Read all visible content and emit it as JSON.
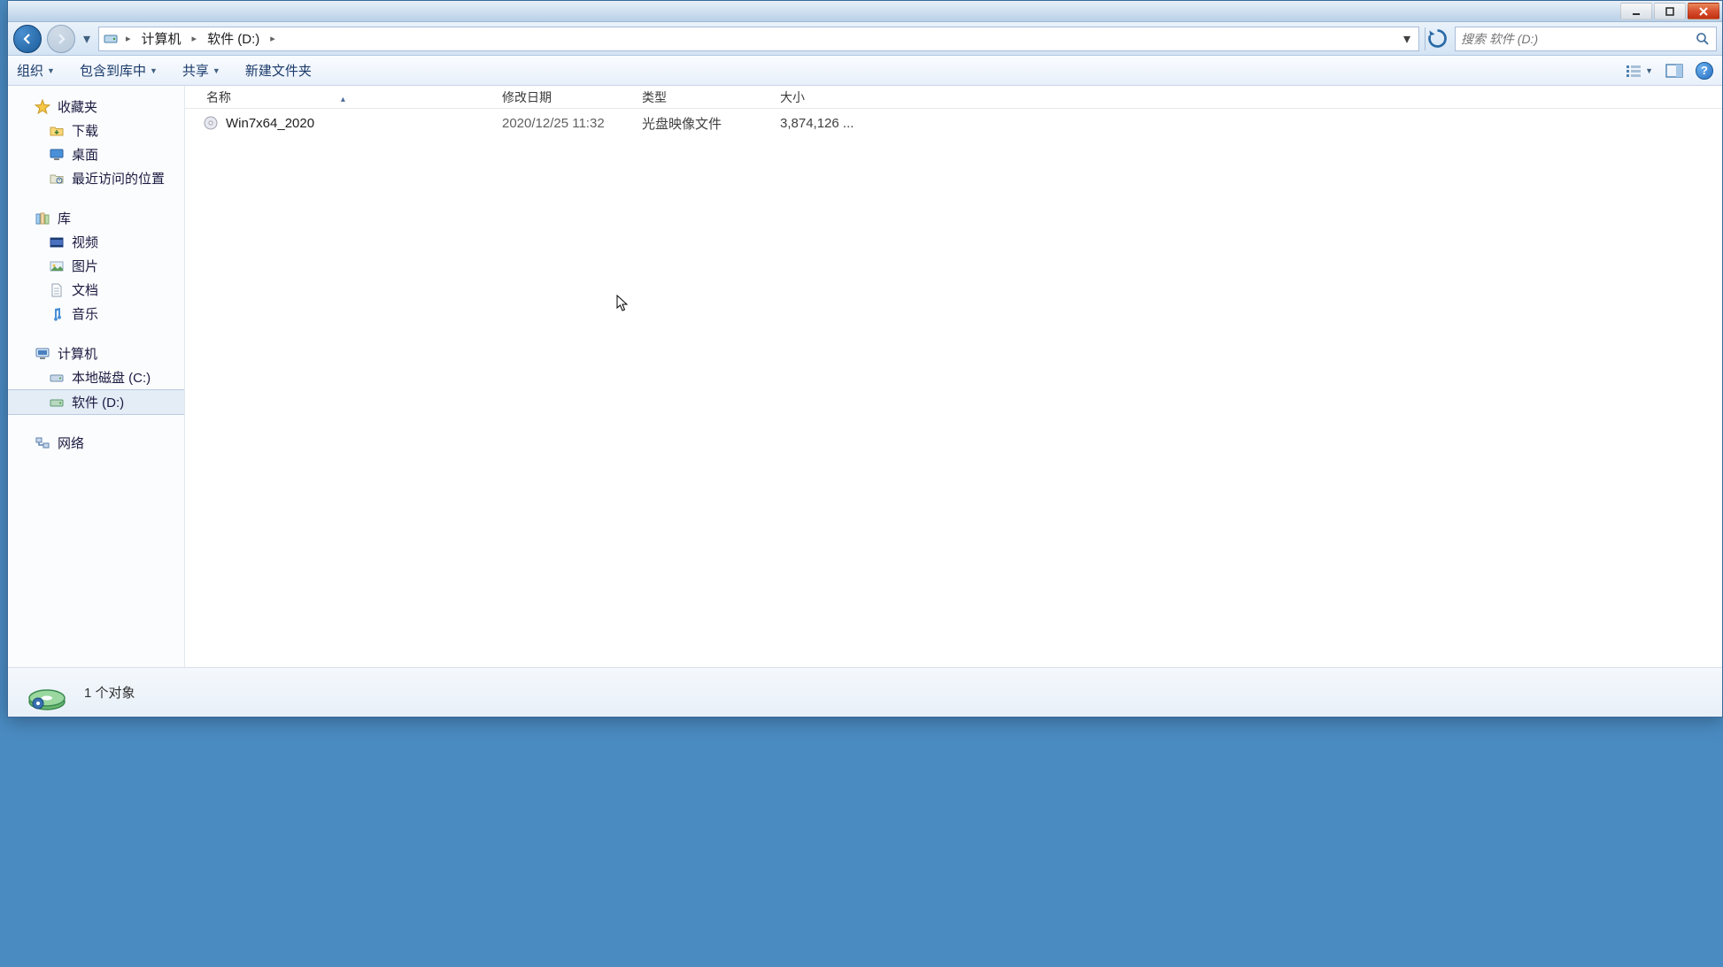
{
  "breadcrumbs": {
    "root_icon": "computer",
    "seg1": "计算机",
    "seg2": "软件 (D:)"
  },
  "search": {
    "placeholder": "搜索 软件 (D:)"
  },
  "toolbar": {
    "organize": "组织",
    "include": "包含到库中",
    "share": "共享",
    "newfolder": "新建文件夹"
  },
  "columns": {
    "name": "名称",
    "date": "修改日期",
    "type": "类型",
    "size": "大小"
  },
  "sidebar": {
    "favorites": {
      "label": "收藏夹",
      "items": [
        {
          "label": "下载"
        },
        {
          "label": "桌面"
        },
        {
          "label": "最近访问的位置"
        }
      ]
    },
    "libraries": {
      "label": "库",
      "items": [
        {
          "label": "视频"
        },
        {
          "label": "图片"
        },
        {
          "label": "文档"
        },
        {
          "label": "音乐"
        }
      ]
    },
    "computer": {
      "label": "计算机",
      "items": [
        {
          "label": "本地磁盘 (C:)"
        },
        {
          "label": "软件 (D:)",
          "selected": true
        }
      ]
    },
    "network": {
      "label": "网络"
    }
  },
  "files": [
    {
      "name": "Win7x64_2020",
      "date": "2020/12/25 11:32",
      "type": "光盘映像文件",
      "size": "3,874,126 ..."
    }
  ],
  "status": {
    "text": "1 个对象"
  }
}
